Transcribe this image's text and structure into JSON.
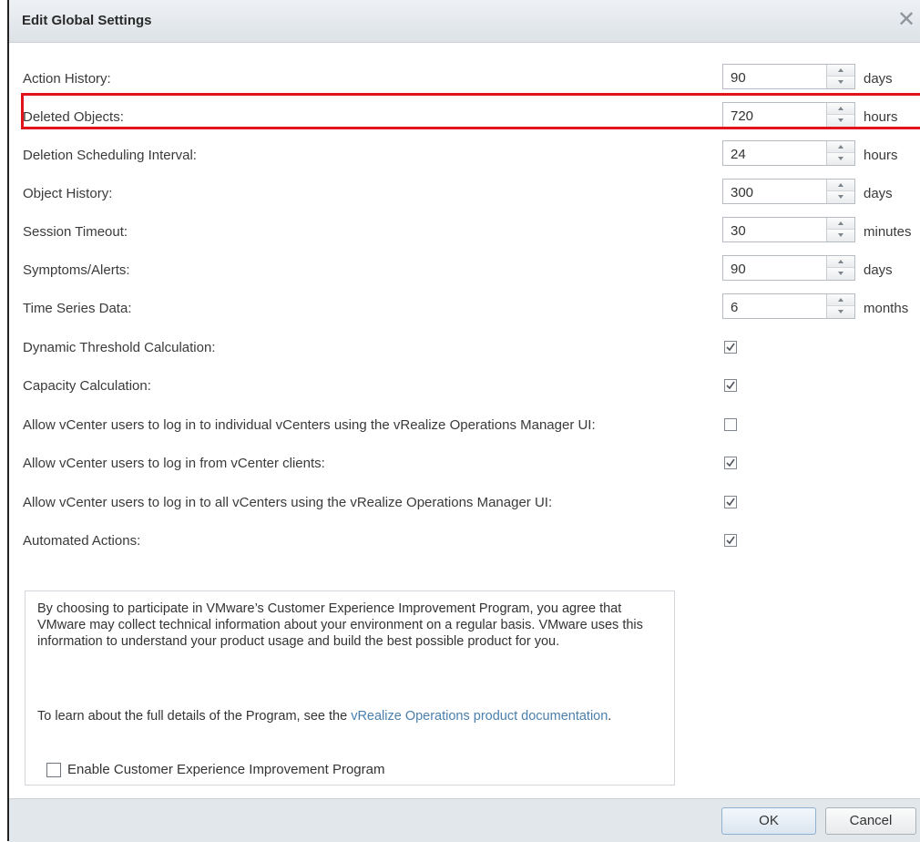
{
  "dialog": {
    "title": "Edit Global Settings",
    "close_glyph": "✕"
  },
  "numeric_settings": [
    {
      "label": "Action History:",
      "value": "90",
      "unit": "days"
    },
    {
      "label": "Deleted Objects:",
      "value": "720",
      "unit": "hours"
    },
    {
      "label": "Deletion Scheduling Interval:",
      "value": "24",
      "unit": "hours"
    },
    {
      "label": "Object History:",
      "value": "300",
      "unit": "days"
    },
    {
      "label": "Session Timeout:",
      "value": "30",
      "unit": "minutes"
    },
    {
      "label": "Symptoms/Alerts:",
      "value": "90",
      "unit": "days"
    },
    {
      "label": "Time Series Data:",
      "value": "6",
      "unit": "months"
    }
  ],
  "checkbox_settings": [
    {
      "label": "Dynamic Threshold Calculation:",
      "checked": true
    },
    {
      "label": "Capacity Calculation:",
      "checked": true
    },
    {
      "label": "Allow vCenter users to log in to individual vCenters using the vRealize Operations Manager UI:",
      "checked": false
    },
    {
      "label": "Allow vCenter users to log in from vCenter clients:",
      "checked": true
    },
    {
      "label": "Allow vCenter users to log in to all vCenters using the vRealize Operations Manager UI:",
      "checked": true
    },
    {
      "label": "Automated Actions:",
      "checked": true
    }
  ],
  "info": {
    "paragraph1": "By choosing to participate in VMware’s Customer Experience Improvement Program, you agree that VMware may collect technical information about your environment on a regular basis. VMware uses this information to understand your product usage and build the best possible product for you.",
    "paragraph2_prefix": "To learn about the full details of the Program, see the ",
    "link_text": "vRealize Operations product documentation",
    "paragraph2_suffix": ".",
    "ceip_label": "Enable Customer Experience Improvement Program",
    "ceip_checked": false
  },
  "footer": {
    "ok_label": "OK",
    "cancel_label": "Cancel"
  },
  "colors": {
    "highlight": "#e2131a",
    "link": "#4a7fae",
    "titlebar": "#dde2e7",
    "footer": "#e2e7ec"
  }
}
